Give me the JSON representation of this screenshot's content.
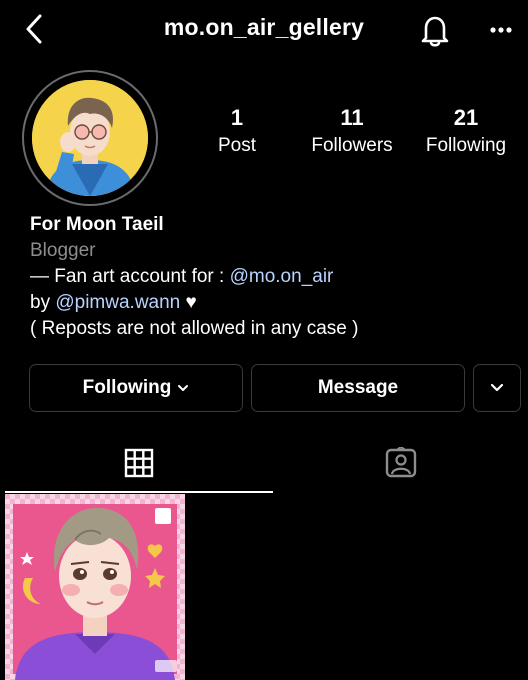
{
  "header": {
    "username": "mo.on_air_gellery",
    "back_icon": "chevron-left-icon",
    "notification_icon": "bell-icon",
    "more_icon": "more-horizontal-icon"
  },
  "profile": {
    "avatar_icon": "profile-avatar",
    "stats": [
      {
        "value": "1",
        "label": "Post"
      },
      {
        "value": "11",
        "label": "Followers"
      },
      {
        "value": "21",
        "label": "Following"
      }
    ],
    "name": "For Moon Taeil",
    "category": "Blogger",
    "bio": {
      "line1_prefix": "— Fan art account for : ",
      "line1_mention": "@mo.on_air",
      "line2_prefix": "by ",
      "line2_mention": "@pimwa.wann",
      "line2_heart": "♥",
      "line3": "( Reposts are not allowed in any case )"
    }
  },
  "actions": {
    "following_label": "Following",
    "message_label": "Message"
  },
  "tabs": [
    {
      "icon": "grid-icon",
      "active": true
    },
    {
      "icon": "tagged-user-icon",
      "active": false
    }
  ],
  "posts": [
    {
      "thumbnail": "fan-art-portrait"
    }
  ],
  "colors": {
    "background": "#000000",
    "text": "#ffffff",
    "secondary_text": "#8e8e8e",
    "mention": "#b9d3ff",
    "border": "#3a3a3a"
  }
}
